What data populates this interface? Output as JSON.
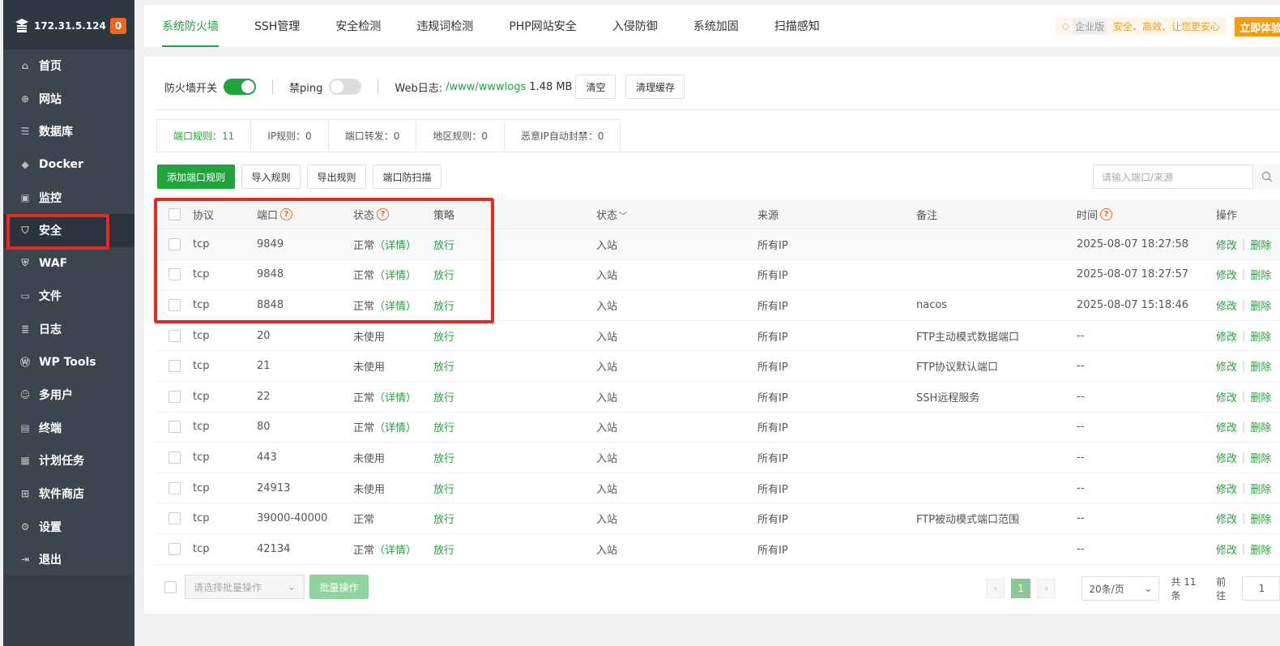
{
  "sidebar": {
    "ip": "172.31.5.124",
    "badge": "0",
    "items": [
      {
        "label": "首页",
        "icon": "home-icon",
        "glyph": "⌂"
      },
      {
        "label": "网站",
        "icon": "globe-icon",
        "glyph": "⊕"
      },
      {
        "label": "数据库",
        "icon": "database-icon",
        "glyph": "☰"
      },
      {
        "label": "Docker",
        "icon": "docker-icon",
        "glyph": "◆"
      },
      {
        "label": "监控",
        "icon": "monitor-icon",
        "glyph": "▣"
      },
      {
        "label": "安全",
        "icon": "shield-icon",
        "glyph": "⛉"
      },
      {
        "label": "WAF",
        "icon": "waf-icon",
        "glyph": "⛨"
      },
      {
        "label": "文件",
        "icon": "folder-icon",
        "glyph": "▭"
      },
      {
        "label": "日志",
        "icon": "log-icon",
        "glyph": "≣"
      },
      {
        "label": "WP Tools",
        "icon": "wordpress-icon",
        "glyph": "Ⓦ"
      },
      {
        "label": "多用户",
        "icon": "users-icon",
        "glyph": "☺"
      },
      {
        "label": "终端",
        "icon": "terminal-icon",
        "glyph": "▤"
      },
      {
        "label": "计划任务",
        "icon": "calendar-icon",
        "glyph": "▦"
      },
      {
        "label": "软件商店",
        "icon": "apps-icon",
        "glyph": "⊞"
      },
      {
        "label": "设置",
        "icon": "gear-icon",
        "glyph": "⚙"
      },
      {
        "label": "退出",
        "icon": "logout-icon",
        "glyph": "⇥"
      }
    ]
  },
  "top_tabs": [
    "系统防火墙",
    "SSH管理",
    "安全检测",
    "违规词检测",
    "PHP网站安全",
    "入侵防御",
    "系统加固",
    "扫描感知"
  ],
  "promo": {
    "edition": "企业版",
    "slogan": "安全、高效、让您更安心",
    "buy": "立即体验"
  },
  "controls": {
    "firewall_label": "防火墙开关",
    "ping_label": "禁ping",
    "weblog_label": "Web日志:",
    "weblog_path": "/www/wwwlogs",
    "weblog_size": "1.48 MB",
    "clear_btn": "清空",
    "clear_cache_btn": "清理缓存"
  },
  "subtabs": [
    "端口规则：11",
    "IP规则：0",
    "端口转发：0",
    "地区规则：0",
    "恶意IP自动封禁：0"
  ],
  "actions": {
    "add": "添加端口规则",
    "import": "导入规则",
    "export": "导出规则",
    "scan": "端口防扫描",
    "search_placeholder": "请输入端口/来源"
  },
  "table": {
    "headers": {
      "proto": "协议",
      "port": "端口",
      "state": "状态",
      "policy": "策略",
      "dir": "状态",
      "src": "来源",
      "note": "备注",
      "time": "时间",
      "op": "操作"
    },
    "detail_text": "（详情）",
    "edit": "修改",
    "delete": "删除",
    "rows": [
      {
        "proto": "tcp",
        "port": "9849",
        "state": "正常",
        "detail": true,
        "policy": "放行",
        "dir": "入站",
        "src": "所有IP",
        "note": "",
        "time": "2025-08-07 18:27:58"
      },
      {
        "proto": "tcp",
        "port": "9848",
        "state": "正常",
        "detail": true,
        "policy": "放行",
        "dir": "入站",
        "src": "所有IP",
        "note": "",
        "time": "2025-08-07 18:27:57"
      },
      {
        "proto": "tcp",
        "port": "8848",
        "state": "正常",
        "detail": true,
        "policy": "放行",
        "dir": "入站",
        "src": "所有IP",
        "note": "nacos",
        "time": "2025-08-07 15:18:46"
      },
      {
        "proto": "tcp",
        "port": "20",
        "state": "未使用",
        "detail": false,
        "policy": "放行",
        "dir": "入站",
        "src": "所有IP",
        "note": "FTP主动模式数据端口",
        "time": "--"
      },
      {
        "proto": "tcp",
        "port": "21",
        "state": "未使用",
        "detail": false,
        "policy": "放行",
        "dir": "入站",
        "src": "所有IP",
        "note": "FTP协议默认端口",
        "time": "--"
      },
      {
        "proto": "tcp",
        "port": "22",
        "state": "正常",
        "detail": true,
        "policy": "放行",
        "dir": "入站",
        "src": "所有IP",
        "note": "SSH远程服务",
        "time": "--"
      },
      {
        "proto": "tcp",
        "port": "80",
        "state": "正常",
        "detail": true,
        "policy": "放行",
        "dir": "入站",
        "src": "所有IP",
        "note": "",
        "time": "--"
      },
      {
        "proto": "tcp",
        "port": "443",
        "state": "未使用",
        "detail": false,
        "policy": "放行",
        "dir": "入站",
        "src": "所有IP",
        "note": "",
        "time": "--"
      },
      {
        "proto": "tcp",
        "port": "24913",
        "state": "未使用",
        "detail": false,
        "policy": "放行",
        "dir": "入站",
        "src": "所有IP",
        "note": "",
        "time": "--"
      },
      {
        "proto": "tcp",
        "port": "39000-40000",
        "state": "正常",
        "detail": false,
        "policy": "放行",
        "dir": "入站",
        "src": "所有IP",
        "note": "FTP被动模式端口范围",
        "time": "--"
      },
      {
        "proto": "tcp",
        "port": "42134",
        "state": "正常",
        "detail": true,
        "policy": "放行",
        "dir": "入站",
        "src": "所有IP",
        "note": "",
        "time": "--"
      }
    ]
  },
  "footer": {
    "batch_placeholder": "请选择批量操作",
    "batch_btn": "批量操作",
    "page": "1",
    "page_size": "20条/页",
    "total": "共 11 条",
    "goto": "前往",
    "goto_value": "1"
  },
  "colors": {
    "accent": "#20a53a",
    "highlight": "#e52a22",
    "sidebar": "#3c444d",
    "warning": "#f39c12"
  }
}
